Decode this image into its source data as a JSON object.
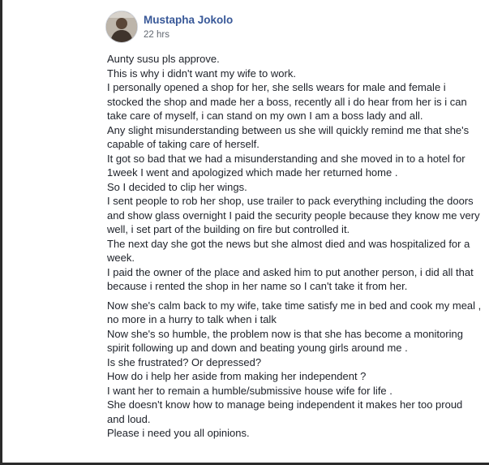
{
  "post": {
    "author": "Mustapha Jokolo",
    "timestamp": "22 hrs",
    "icons": {
      "avatar": "profile-photo",
      "more": "more-options-icon"
    },
    "colors": {
      "author_link": "#385898",
      "timestamp": "#616770",
      "text": "#1d2129"
    },
    "paragraphs_block1": [
      "Aunty susu pls approve.",
      "This is why i didn't want my wife to work.",
      "I personally opened a shop for her, she sells wears for male and female i stocked the shop and made her a boss, recently all i do hear from her is i can take care of myself, i can stand on my own I am a boss lady and all.",
      "Any slight misunderstanding between us she will quickly remind me that she's capable of taking care of herself.",
      "It got so bad that we had a misunderstanding and she moved in to a hotel for 1week I went and apologized which made her returned home .",
      "So I decided to clip her wings.",
      "I sent people to rob her shop, use trailer to pack everything including the doors and show glass overnight I paid the security people because they know me very well, i set part of the building on fire but controlled it.",
      "The next day she got the news but she almost died and was hospitalized for a week.",
      "I paid the owner of the place and asked him to put another person, i did all that because i rented the shop in her name so I can't take it from her."
    ],
    "paragraphs_block2": [
      "Now she's calm back to my wife, take time satisfy me in bed and cook my meal , no more in a hurry to talk when i talk",
      "Now she's so humble, the problem now is that she has become a monitoring spirit following up and down and beating young girls around me .",
      "Is she frustrated? Or depressed?",
      "How do i help her aside from making her independent ?",
      "I want her to remain a humble/submissive house wife for life .",
      "She doesn't know how to manage being independent it makes her too proud and loud.",
      "Please i need you all opinions."
    ]
  }
}
